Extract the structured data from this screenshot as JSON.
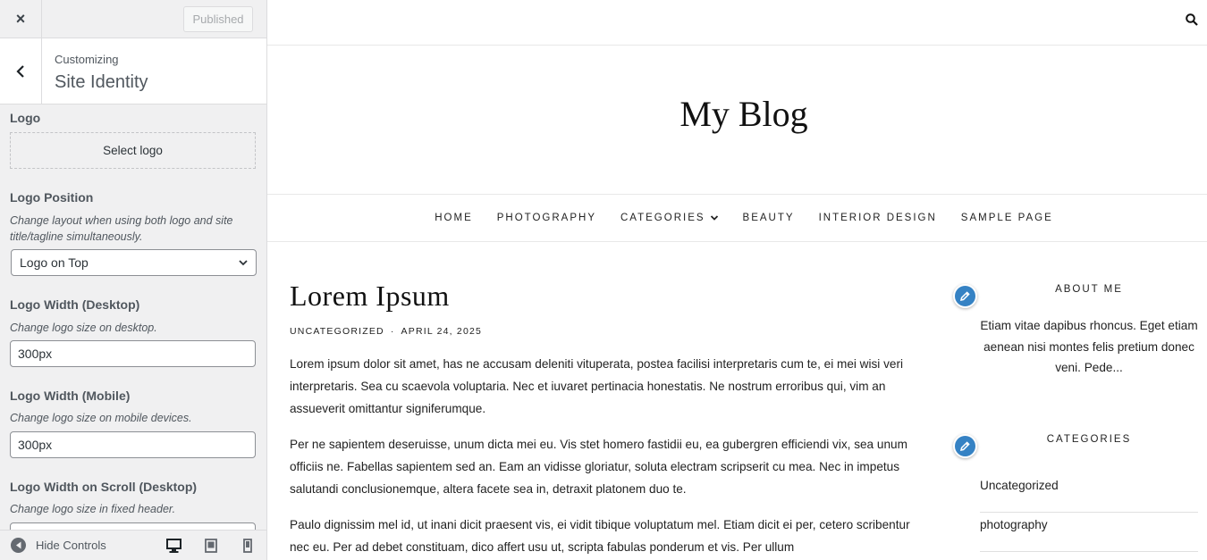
{
  "sidebar": {
    "close_label": "×",
    "publish_label": "Published",
    "breadcrumb": "Customizing",
    "section_title": "Site Identity",
    "logo": {
      "label": "Logo",
      "button": "Select logo"
    },
    "logo_position": {
      "label": "Logo Position",
      "description": "Change layout when using both logo and site title/tagline simultaneously.",
      "selected": "Logo on Top"
    },
    "logo_width_desktop": {
      "label": "Logo Width (Desktop)",
      "description": "Change logo size on desktop.",
      "value": "300px"
    },
    "logo_width_mobile": {
      "label": "Logo Width (Mobile)",
      "description": "Change logo size on mobile devices.",
      "value": "300px"
    },
    "logo_width_scroll": {
      "label": "Logo Width on Scroll (Desktop)",
      "description": "Change logo size in fixed header."
    },
    "footer": {
      "hide_controls": "Hide Controls"
    }
  },
  "preview": {
    "site_title": "My Blog",
    "nav": [
      "HOME",
      "PHOTOGRAPHY",
      "CATEGORIES",
      "BEAUTY",
      "INTERIOR DESIGN",
      "SAMPLE PAGE"
    ],
    "post": {
      "title": "Lorem Ipsum",
      "category": "UNCATEGORIZED",
      "separator": "·",
      "date": "APRIL 24, 2025",
      "paragraphs": [
        "Lorem ipsum dolor sit amet, has ne accusam deleniti vituperata, postea facilisi interpretaris cum te, ei mei wisi veri interpretaris. Sea cu scaevola voluptaria. Nec et iuvaret pertinacia honestatis. Ne nostrum erroribus qui, vim an assueverit omittantur signiferumque.",
        "Per ne sapientem deseruisse, unum dicta mei eu. Vis stet homero fastidii eu, ea gubergren efficiendi vix, sea unum officiis ne. Fabellas sapientem sed an. Eam an vidisse gloriatur, soluta electram scripserit cu mea. Nec in impetus salutandi conclusionemque, altera facete sea in, detraxit platonem duo te.",
        "Paulo dignissim mel id, ut inani dicit praesent vis, ei vidit tibique voluptatum mel. Etiam dicit ei per, cetero scribentur nec eu. Per ad debet constituam, dico affert usu ut, scripta fabulas ponderum et vis. Per ullum"
      ]
    },
    "sidebar": {
      "about_title": "ABOUT ME",
      "about_text": "Etiam vitae dapibus rhoncus. Eget etiam aenean nisi montes felis pretium donec veni. Pede...",
      "categories_title": "CATEGORIES",
      "categories": [
        "Uncategorized",
        "photography"
      ]
    }
  },
  "colors": {
    "accent": "#3582c4",
    "sidebar_bg": "#f0f0f1",
    "border": "#dcdcde"
  },
  "icons": [
    "close-icon",
    "back-arrow-icon",
    "chevron-down-icon",
    "search-icon",
    "pencil-icon",
    "desktop-icon",
    "tablet-icon",
    "mobile-icon",
    "hide-controls-icon"
  ]
}
